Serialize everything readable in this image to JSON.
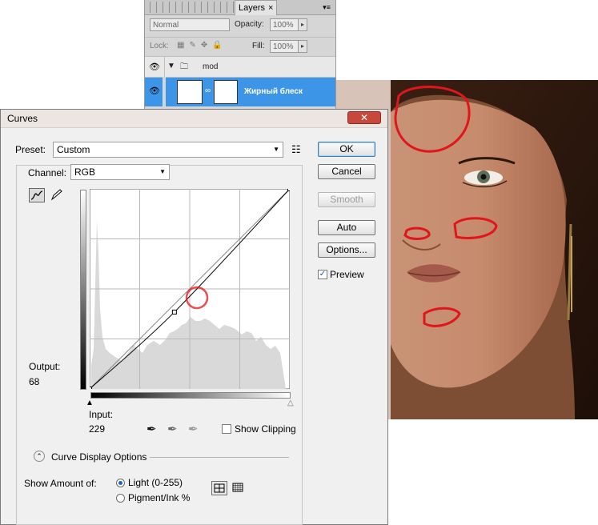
{
  "layers_panel": {
    "tab_label": "Layers",
    "tab_close": "×",
    "blend_mode": "Normal",
    "opacity_label": "Opacity:",
    "opacity_value": "100%",
    "lock_label": "Lock:",
    "fill_label": "Fill:",
    "fill_value": "100%",
    "group_name": "mod",
    "selected_layer_name": "Жирный блеск"
  },
  "dialog": {
    "title": "Curves",
    "close_symbol": "✕",
    "preset_label": "Preset:",
    "preset_value": "Custom",
    "channel_label": "Channel:",
    "channel_value": "RGB",
    "buttons": {
      "ok": "OK",
      "cancel": "Cancel",
      "smooth": "Smooth",
      "auto": "Auto",
      "options": "Options..."
    },
    "preview_label": "Preview",
    "preview_checked": true,
    "output_label": "Output:",
    "output_value": "68",
    "input_label": "Input:",
    "input_value": "229",
    "show_clipping_label": "Show Clipping",
    "display_options_label": "Curve Display Options",
    "show_amount_label": "Show Amount of:",
    "light_label": "Light  (0-255)",
    "pigment_label": "Pigment/Ink %"
  },
  "curve": {
    "points": [
      [
        0,
        0
      ],
      [
        108,
        98
      ],
      [
        255,
        255
      ]
    ]
  },
  "colors": {
    "selection_blue": "#3d95e8",
    "annotation_red": "#e0161c"
  }
}
